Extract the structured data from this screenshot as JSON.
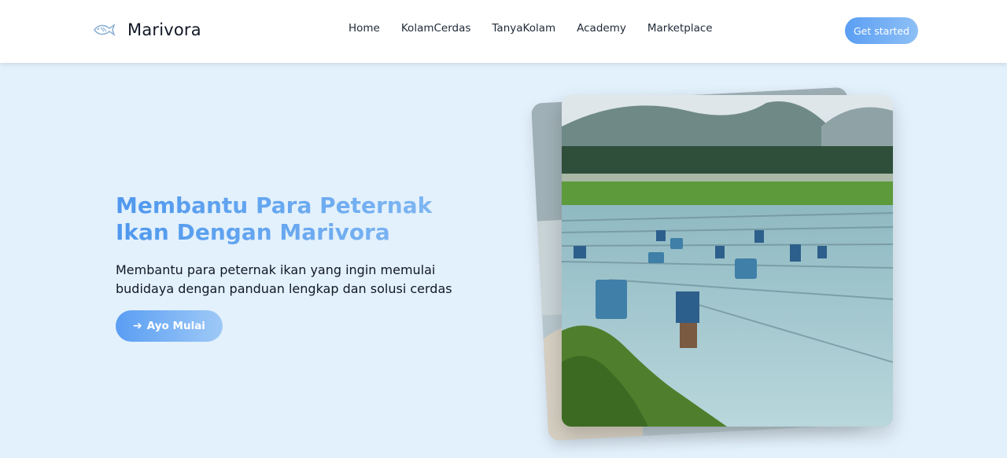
{
  "brand": {
    "name": "Marivora",
    "icon": "fish-icon"
  },
  "nav": {
    "links": [
      "Home",
      "KolamCerdas",
      "TanyaKolam",
      "Academy",
      "Marketplace"
    ],
    "cta_label": "Get started"
  },
  "hero": {
    "title": "Membantu Para Peternak Ikan Dengan Marivora",
    "subtitle": "Membantu para peternak ikan yang ingin memulai budidaya dengan panduan lengkap dan solusi cerdas",
    "button_label": "Ayo Mulai",
    "button_icon": "arrow-right-icon"
  },
  "colors": {
    "page_background": "#e3f1fc",
    "accent": "#5a9ef3",
    "accent_light": "#8ec0f6"
  }
}
